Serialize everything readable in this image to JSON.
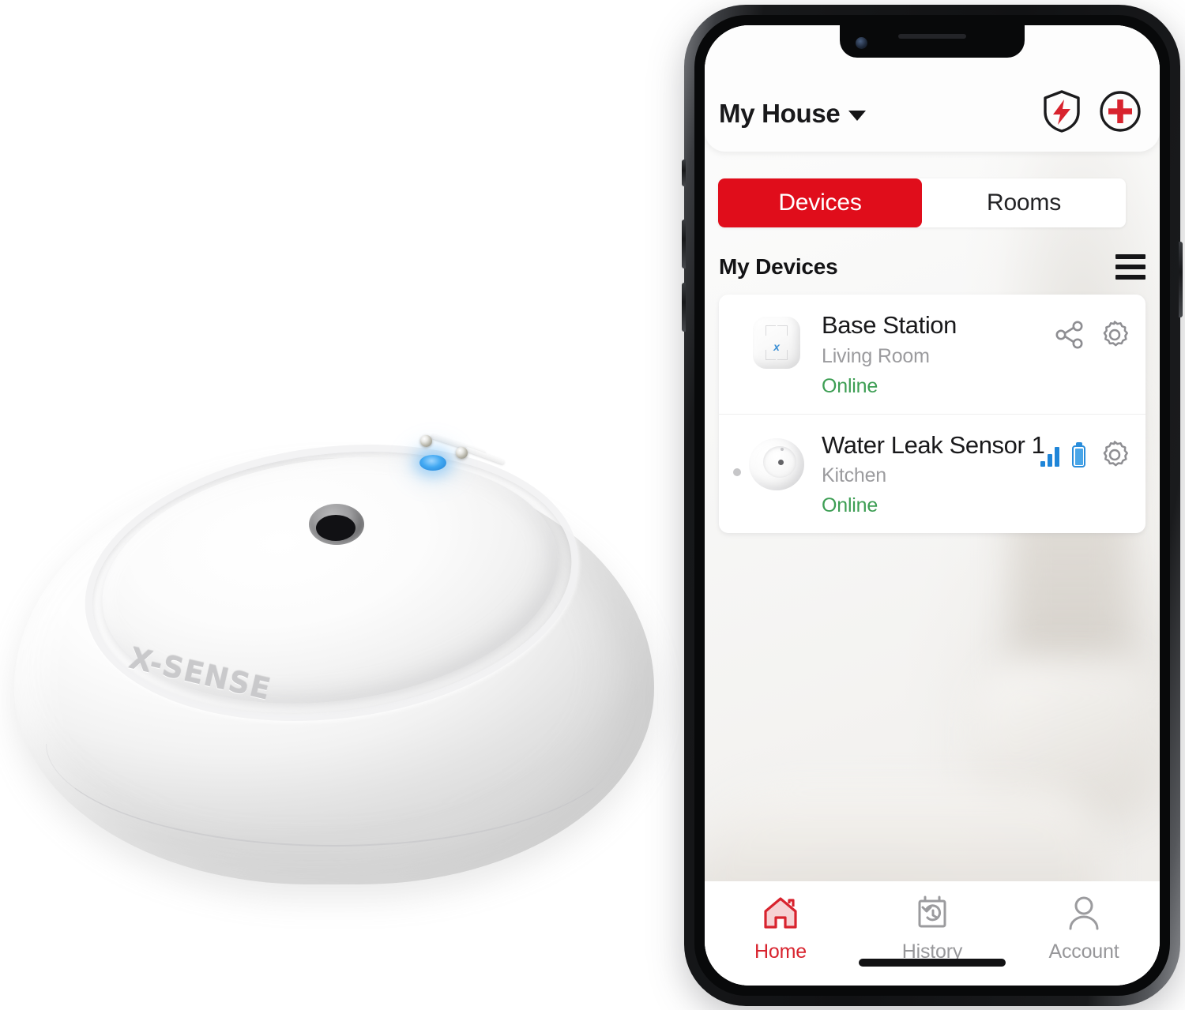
{
  "product": {
    "brand_wordmark": "X-SENSE",
    "name": "water-leak-sensor",
    "led_color": "#43a9f2",
    "body_color": "#ffffff"
  },
  "phone": {
    "device": "smartphone-mockup",
    "frame_color": "#17181a"
  },
  "app": {
    "header": {
      "house_title": "My House",
      "caret_icon": "chevron-down-icon",
      "shield_icon": "shield-bolt-icon",
      "add_icon": "plus-circle-icon",
      "accent_color": "#e00d1b"
    },
    "tabs": {
      "items": [
        {
          "label": "Devices",
          "active": true
        },
        {
          "label": "Rooms",
          "active": false
        }
      ],
      "active_bg": "#e00d1b"
    },
    "section": {
      "title": "My Devices",
      "menu_icon": "hamburger-menu-icon"
    },
    "devices": [
      {
        "name": "Base Station",
        "room": "Living Room",
        "status": "Online",
        "status_color": "#3d9e54",
        "thumb_icon": "base-station-icon",
        "actions": [
          "share-icon",
          "gear-icon"
        ]
      },
      {
        "name": "Water Leak Sensor 1",
        "room": "Kitchen",
        "status": "Online",
        "status_color": "#3d9e54",
        "thumb_icon": "water-leak-sensor-icon",
        "actions": [
          "signal-strength-icon",
          "battery-full-icon",
          "gear-icon"
        ]
      }
    ],
    "tabbar": {
      "items": [
        {
          "label": "Home",
          "icon": "home-icon",
          "active": true
        },
        {
          "label": "History",
          "icon": "history-clock-icon",
          "active": false
        },
        {
          "label": "Account",
          "icon": "person-icon",
          "active": false
        }
      ],
      "active_color": "#d8232e",
      "inactive_color": "#97979a"
    }
  }
}
